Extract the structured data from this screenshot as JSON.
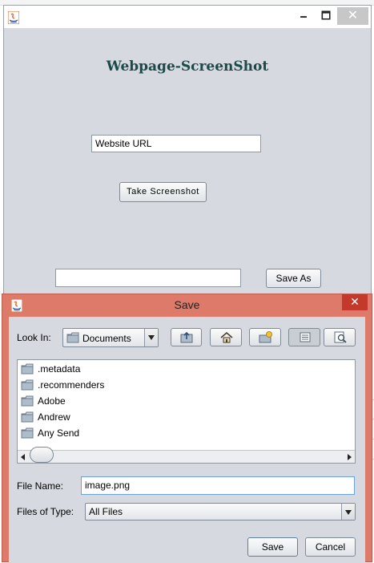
{
  "main_window": {
    "app_title": "Webpage-ScreenShot",
    "url_value": "Website URL",
    "take_screenshot_label": "Take  Screenshot",
    "save_path_value": "",
    "save_as_label": "Save As",
    "controls": {
      "minimize": "🗕",
      "maximize": "🗖",
      "close": "✕"
    }
  },
  "save_dialog": {
    "title": "Save",
    "close": "✕",
    "look_in_label": "Look In:",
    "look_in_value": "Documents",
    "files": [
      ".metadata",
      ".recommenders",
      "Adobe",
      "Andrew",
      "Any Send"
    ],
    "file_name_label": "File Name:",
    "file_name_value": "image.png",
    "files_of_type_label": "Files of Type:",
    "files_of_type_value": "All Files",
    "save_label": "Save",
    "cancel_label": "Cancel",
    "toolbar_icons": [
      "up-one-level-icon",
      "home-icon",
      "new-folder-icon",
      "list-view-icon",
      "details-view-icon"
    ]
  },
  "colors": {
    "dialog_accent": "#de7a6a",
    "close_red": "#c4392b",
    "title_green": "#1b4a4a",
    "window_bg": "#d6d9df"
  }
}
